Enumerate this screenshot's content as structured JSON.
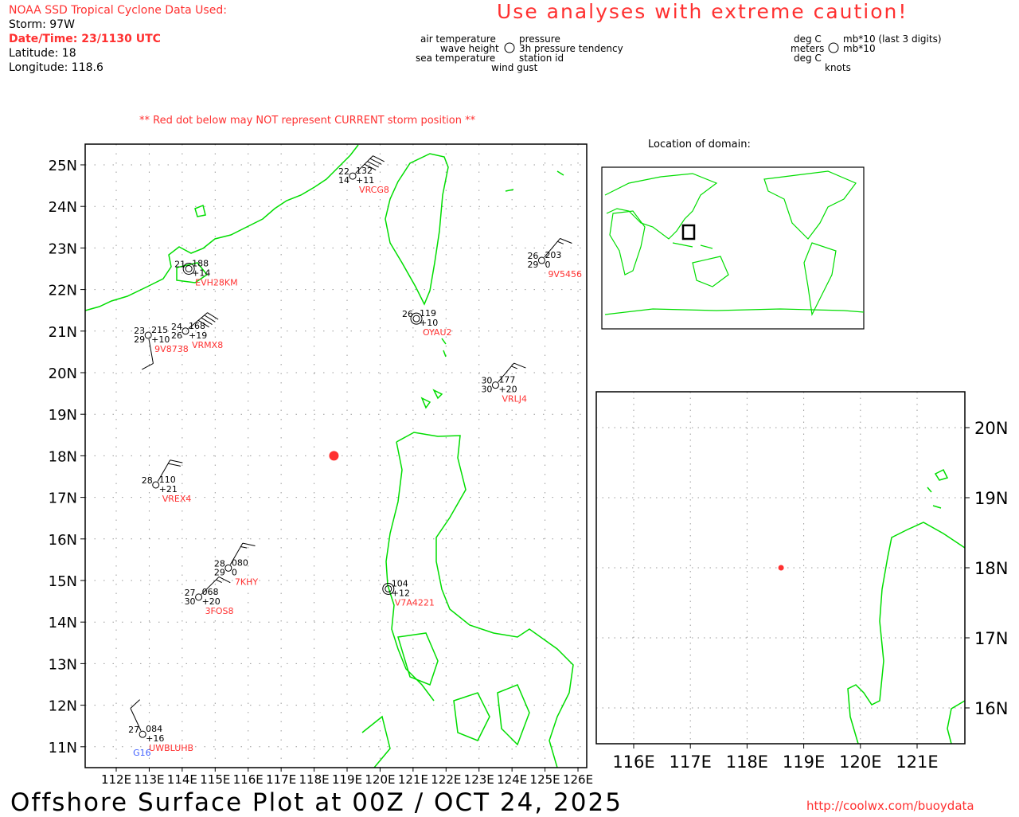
{
  "header": {
    "source": "NOAA SSD Tropical Cyclone Data Used:",
    "storm": "Storm: 97W",
    "datetime": "Date/Time: 23/1130 UTC",
    "latitude": "Latitude: 18",
    "longitude": "Longitude: 118.6"
  },
  "warning": "Use analyses with extreme caution!",
  "legend": {
    "left": {
      "air_temperature": "air temperature",
      "wave_height": "wave height",
      "sea_temperature": "sea temperature",
      "pressure": "pressure",
      "tendency": "3h pressure tendency",
      "station_id": "station id",
      "wind_gust": "wind gust"
    },
    "right": {
      "air_unit": "deg C",
      "wave_unit": "meters",
      "sea_unit": "deg C",
      "pressure_unit": "mb*10 (last 3 digits)",
      "tendency_unit": "mb*10",
      "wind_unit": "knots"
    }
  },
  "note": "** Red dot below may NOT represent CURRENT storm position **",
  "domain_label": "Location of domain:",
  "storm_position": {
    "lat": 18,
    "lon": 118.6,
    "color": "#ff3030"
  },
  "main_map": {
    "lat_labels": [
      "25N",
      "24N",
      "23N",
      "22N",
      "21N",
      "20N",
      "19N",
      "18N",
      "17N",
      "16N",
      "15N",
      "14N",
      "13N",
      "12N",
      "11N"
    ],
    "lon_labels": [
      "112E",
      "113E",
      "114E",
      "115E",
      "116E",
      "117E",
      "118E",
      "119E",
      "120E",
      "121E",
      "122E",
      "123E",
      "124E",
      "125E",
      "126E"
    ]
  },
  "inset_map": {
    "lat_labels": [
      "20N",
      "19N",
      "18N",
      "17N",
      "16N"
    ],
    "lon_labels": [
      "116E",
      "117E",
      "118E",
      "119E",
      "120E",
      "121E"
    ]
  },
  "stations": [
    {
      "id": "VRCG8",
      "lat": 24.73,
      "lon": 119.17,
      "air": "22",
      "sea": "14",
      "pres": "132",
      "tend": "+11",
      "wind_from": 45,
      "wind_kt": 40
    },
    {
      "id": "EVH28KM",
      "lat": 22.5,
      "lon": 114.2,
      "air": "21",
      "sea": "",
      "pres": "188",
      "tend": "+14",
      "wind_from": null,
      "wind_kt": 0,
      "double": true
    },
    {
      "id": "9V8738",
      "lat": 20.9,
      "lon": 112.97,
      "air": "23",
      "sea": "29",
      "pres": "215",
      "tend": "+10",
      "wind_from": 170,
      "wind_kt": 10
    },
    {
      "id": "VRMX8",
      "lat": 21.0,
      "lon": 114.1,
      "air": "24",
      "sea": "26",
      "pres": "168",
      "tend": "+19",
      "wind_from": 50,
      "wind_kt": 40
    },
    {
      "id": "OYAU2",
      "lat": 21.3,
      "lon": 121.1,
      "air": "26",
      "sea": "",
      "pres": "119",
      "tend": "+10",
      "wind_from": null,
      "wind_kt": 0,
      "double": true
    },
    {
      "id": "9V5456",
      "lat": 22.7,
      "lon": 124.9,
      "air": "26",
      "sea": "29",
      "pres": "203",
      "tend": "0",
      "wind_from": 40,
      "wind_kt": 15
    },
    {
      "id": "VRLJ4",
      "lat": 19.7,
      "lon": 123.5,
      "air": "30",
      "sea": "30",
      "pres": "177",
      "tend": "+20",
      "wind_from": 40,
      "wind_kt": 15
    },
    {
      "id": "VREX4",
      "lat": 17.3,
      "lon": 113.2,
      "air": "28",
      "sea": "",
      "pres": "110",
      "tend": "+21",
      "wind_from": 30,
      "wind_kt": 20
    },
    {
      "id": "7KHY",
      "lat": 15.3,
      "lon": 115.4,
      "air": "28",
      "sea": "29",
      "pres": "080",
      "tend": "0",
      "wind_from": 30,
      "wind_kt": 15
    },
    {
      "id": "3FOS8",
      "lat": 14.6,
      "lon": 114.5,
      "air": "27",
      "sea": "30",
      "pres": "068",
      "tend": "+20",
      "wind_from": 45,
      "wind_kt": 15
    },
    {
      "id": "V7A4221",
      "lat": 14.8,
      "lon": 120.25,
      "air": "",
      "sea": "",
      "pres": "104",
      "tend": "+12",
      "wind_from": null,
      "wind_kt": 0,
      "double": true
    },
    {
      "id": "UWBLUHB",
      "lat": 11.3,
      "lon": 112.8,
      "air": "27",
      "sea": "",
      "pres": "084",
      "tend": "+16",
      "wind_from": 335,
      "wind_kt": 10,
      "gust": "G16"
    }
  ],
  "footer": {
    "title": "Offshore Surface Plot at 00Z / OCT 24, 2025",
    "url": "http://coolwx.com/buoydata"
  },
  "colors": {
    "land": "#00dd00",
    "text_red": "#ff3030",
    "gust": "#4060ff"
  }
}
